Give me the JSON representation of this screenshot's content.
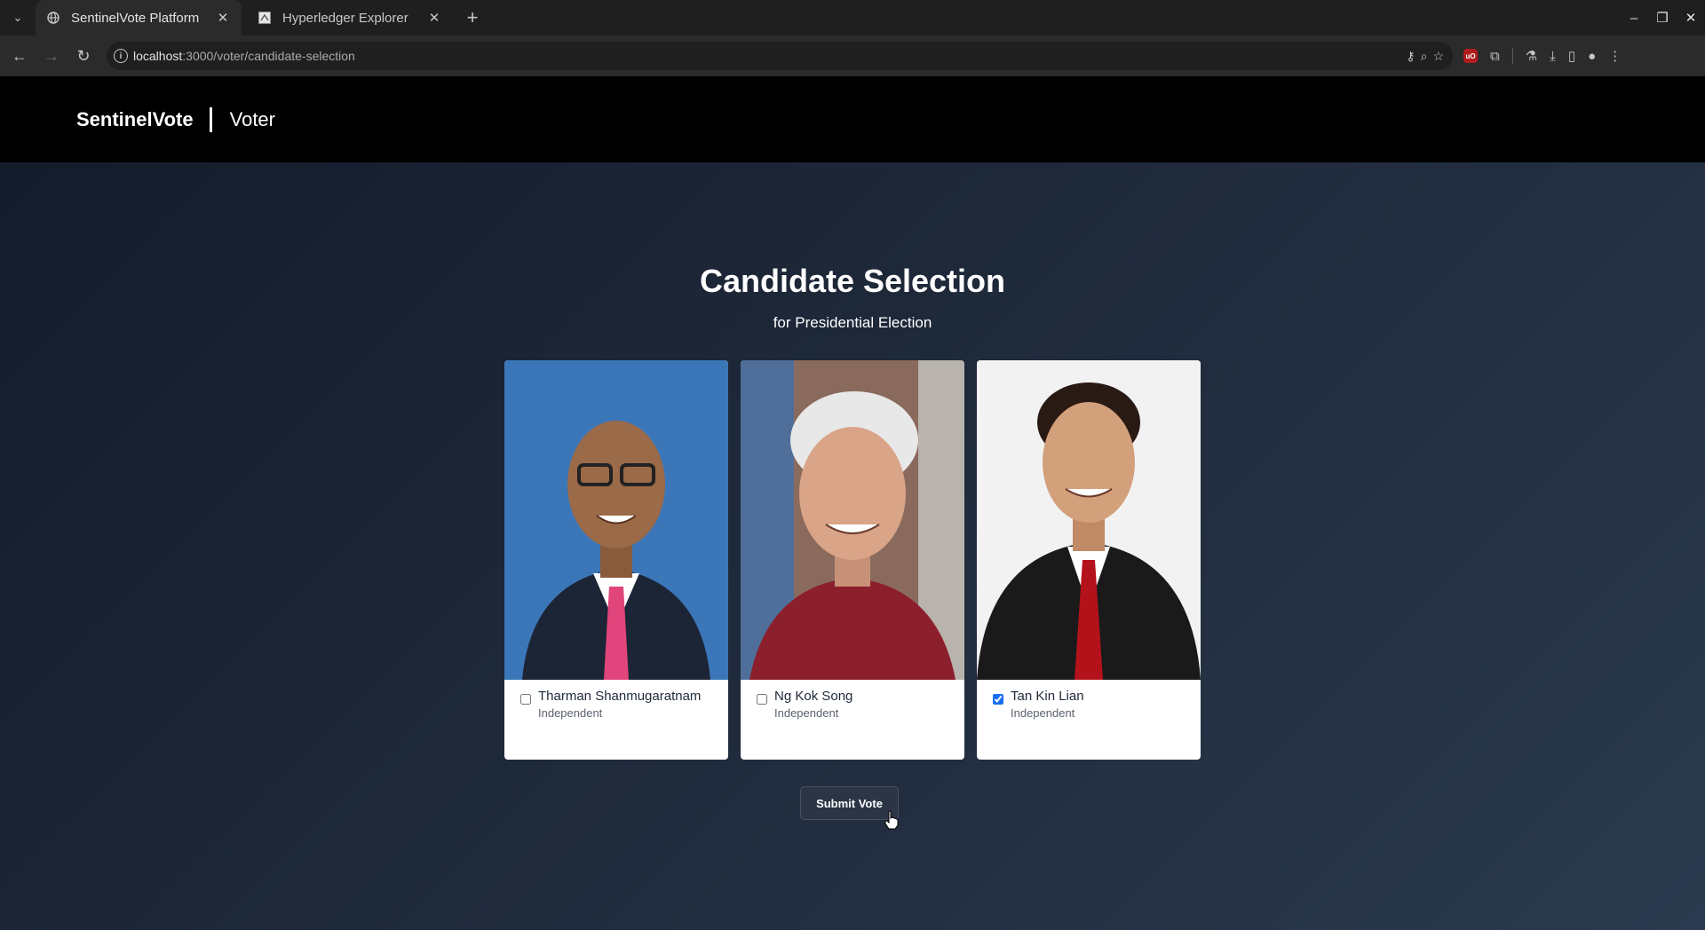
{
  "browser": {
    "tabs": [
      {
        "title": "SentinelVote Platform",
        "active": true,
        "icon": "globe-icon"
      },
      {
        "title": "Hyperledger Explorer",
        "active": false,
        "icon": "hyperledger-icon"
      }
    ],
    "url": {
      "host": "localhost",
      "path": ":3000/voter/candidate-selection"
    }
  },
  "header": {
    "brand": "SentinelVote",
    "role": "Voter"
  },
  "main": {
    "title": "Candidate Selection",
    "subtitle": "for Presidential Election",
    "candidates": [
      {
        "name": "Tharman Shanmugaratnam",
        "party": "Independent",
        "checked": false,
        "photo_bg": "#3b76b8",
        "suit": "#1c2536",
        "tie": "#e0457b"
      },
      {
        "name": "Ng Kok Song",
        "party": "Independent",
        "checked": false,
        "photo_bg": "#8a6a5d",
        "suit": "#8c1f2c",
        "tie": "#8c1f2c"
      },
      {
        "name": "Tan Kin Lian",
        "party": "Independent",
        "checked": true,
        "photo_bg": "#f2f2f2",
        "suit": "#1a1a1a",
        "tie": "#b3121b"
      }
    ],
    "submit_label": "Submit Vote"
  },
  "colors": {
    "header_bg": "#000000",
    "page_bg": "#1f2a3b",
    "accent": "#1a6ff0"
  }
}
